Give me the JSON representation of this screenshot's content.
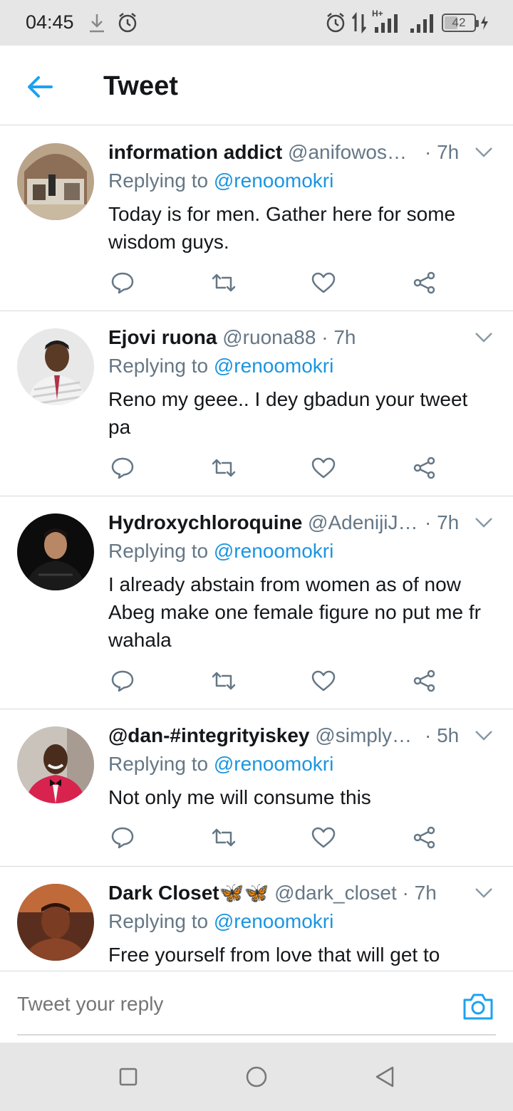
{
  "status_bar": {
    "time": "04:45",
    "battery": "42",
    "network": "H+"
  },
  "header": {
    "title": "Tweet"
  },
  "tweets": [
    {
      "name": "information addict",
      "handle": "@anifowos…",
      "time": "· 7h",
      "replying_prefix": "Replying to ",
      "mention": "@renoomokri",
      "text": "Today is for men. Gather here for some wisdom guys."
    },
    {
      "name": "Ejovi ruona",
      "handle": "@ruona88 · 7h",
      "time": "",
      "replying_prefix": "Replying to ",
      "mention": "@renoomokri",
      "text": "Reno my geee.. I dey gbadun your tweet pa"
    },
    {
      "name": "Hydroxychloroquine",
      "handle": "@AdenijiJ…",
      "time": "· 7h",
      "replying_prefix": "Replying to ",
      "mention": "@renoomokri",
      "text": "I already abstain from women as of now Abeg make one female figure no put me fr wahala"
    },
    {
      "name": "@dan-#integrityiskey",
      "handle": "@simply…",
      "time": "· 5h",
      "replying_prefix": "Replying to ",
      "mention": "@renoomokri",
      "text": "Not only me will consume this"
    },
    {
      "name": "Dark Closet🦋🦋",
      "handle": "@dark_closet · 7h",
      "time": "",
      "replying_prefix": "Replying to ",
      "mention": "@renoomokri",
      "text": "Free yourself from love that will get to"
    }
  ],
  "composer": {
    "placeholder": "Tweet your reply"
  },
  "colors": {
    "accent": "#1da1f2",
    "mention": "#1b95e0",
    "secondary_text": "#657786",
    "divider": "#d6d9db"
  }
}
